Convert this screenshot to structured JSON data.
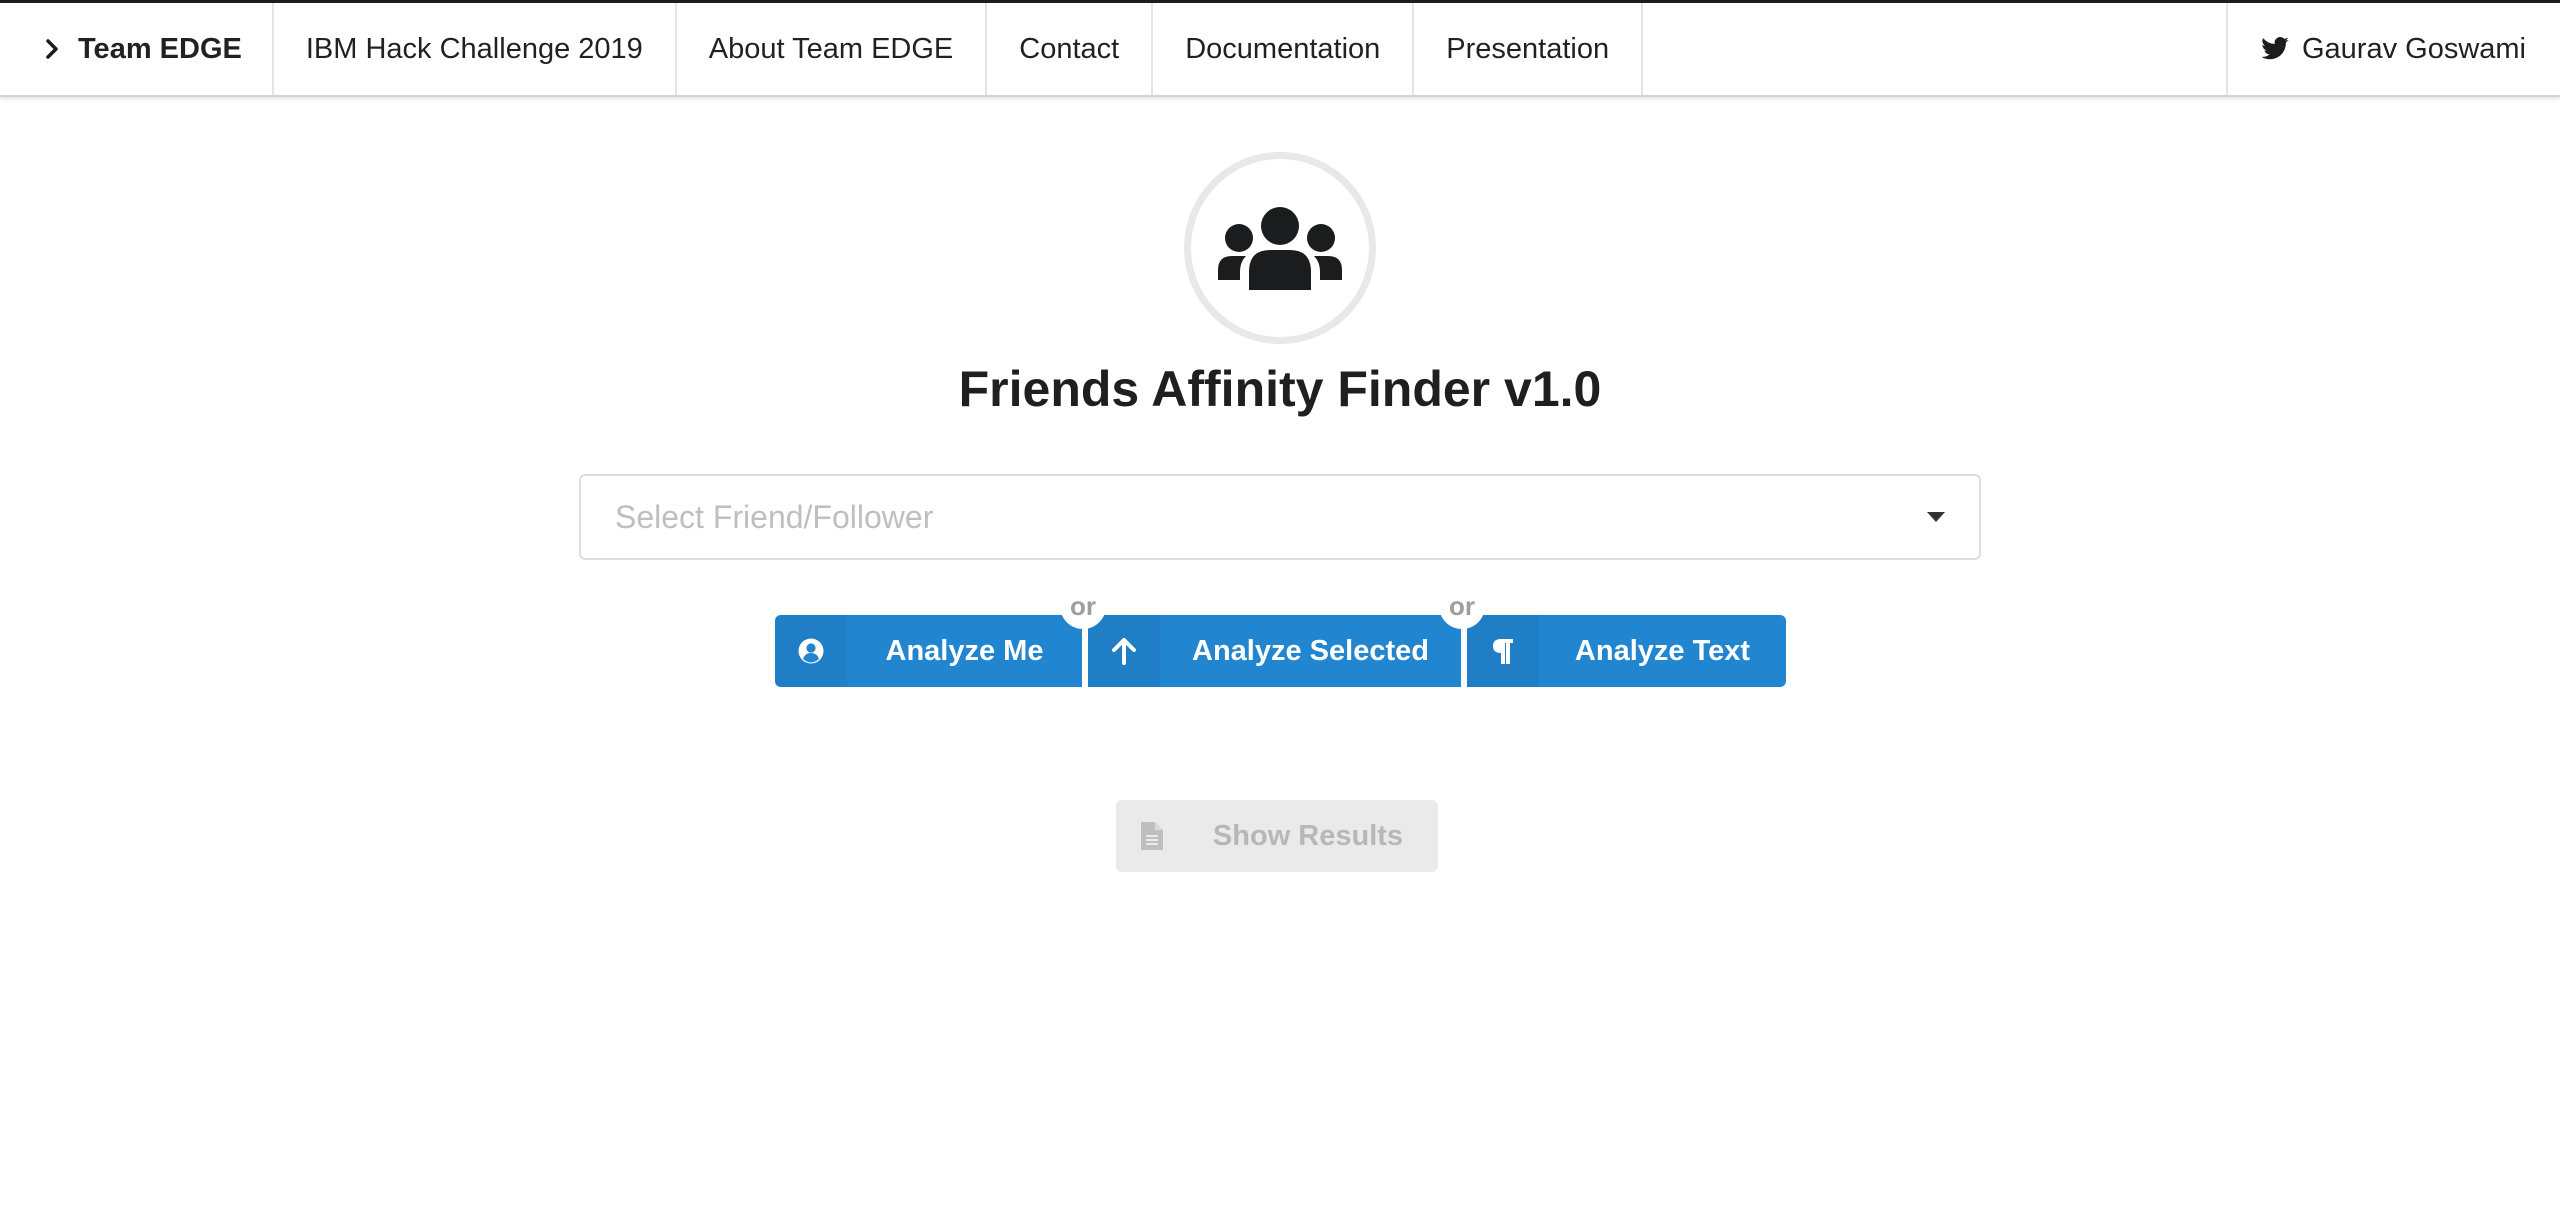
{
  "nav": {
    "brand": "Team EDGE",
    "items": [
      {
        "label": "IBM Hack Challenge 2019"
      },
      {
        "label": "About Team EDGE"
      },
      {
        "label": "Contact"
      },
      {
        "label": "Documentation"
      },
      {
        "label": "Presentation"
      }
    ],
    "user": "Gaurav Goswami"
  },
  "header": {
    "icon": "users-icon",
    "title": "Friends Affinity Finder v1.0"
  },
  "friend_select": {
    "placeholder": "Select Friend/Follower",
    "value": ""
  },
  "actions": {
    "analyze_me": "Analyze Me",
    "analyze_selected": "Analyze Selected",
    "analyze_text": "Analyze Text",
    "or_label": "or",
    "show_results": "Show Results",
    "show_results_enabled": false
  },
  "colors": {
    "primary": "#2185d0",
    "disabled_bg": "#e8e8e8",
    "disabled_text": "#b0b0b0"
  }
}
